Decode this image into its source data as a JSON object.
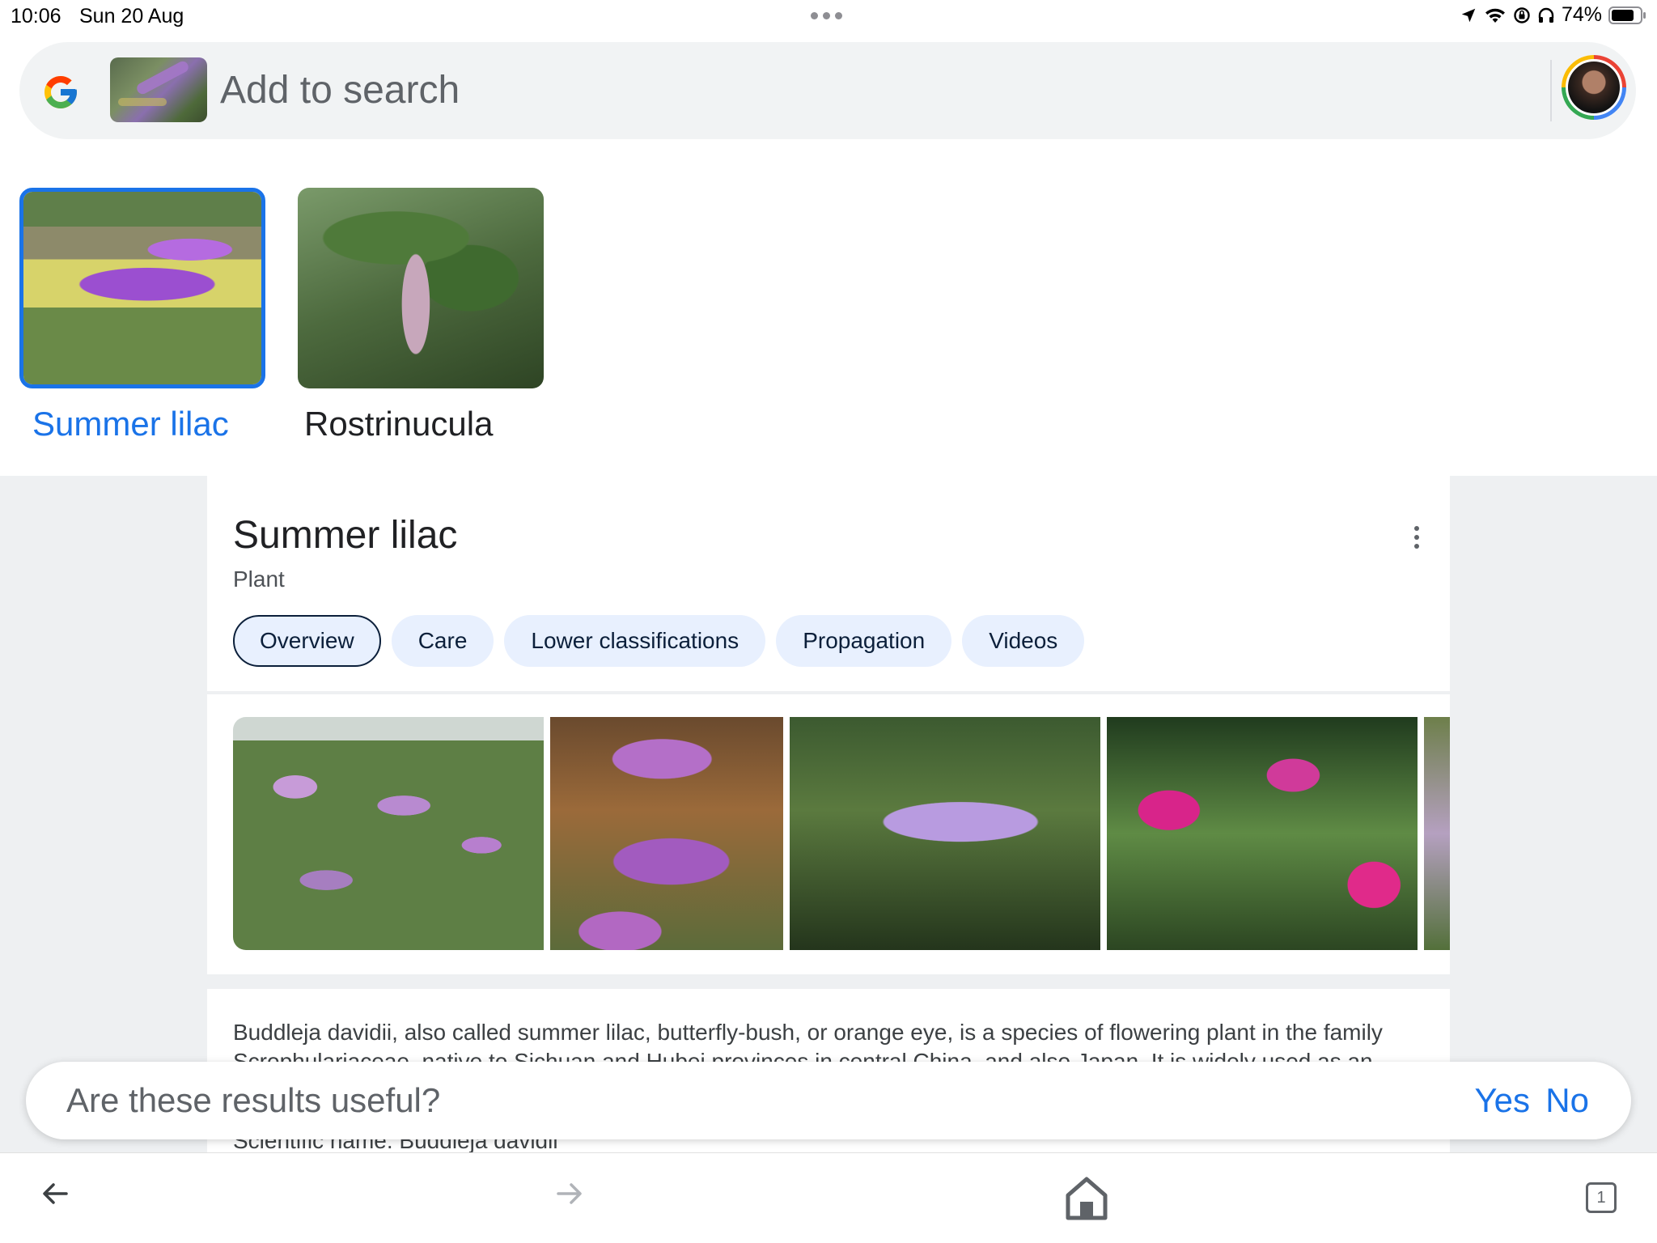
{
  "status_bar": {
    "time": "10:06",
    "date": "Sun 20 Aug",
    "battery_percent": "74%",
    "icons": [
      "location-arrow-icon",
      "wifi-icon",
      "rotation-lock-icon",
      "headphones-icon",
      "battery-icon"
    ]
  },
  "search": {
    "placeholder": "Add to search"
  },
  "results": [
    {
      "label": "Summer lilac",
      "selected": true
    },
    {
      "label": "Rostrinucula",
      "selected": false
    }
  ],
  "panel": {
    "title": "Summer lilac",
    "subtitle": "Plant",
    "tabs": [
      "Overview",
      "Care",
      "Lower classifications",
      "Propagation",
      "Videos"
    ],
    "active_tab": "Overview",
    "description": "Buddleja davidii, also called summer lilac, butterfly-bush, or orange eye, is a species of flowering plant in the family Scrophulariaceae, native to Sichuan and Hubei provinces in central China, and also Japan. It is widely used as an ornamental plant.",
    "fact_line": "Scientific name: Buddleja davidii"
  },
  "feedback": {
    "question": "Are these results useful?",
    "yes": "Yes",
    "no": "No"
  },
  "toolbar": {
    "tab_count": "1"
  },
  "colors": {
    "accent": "#1a73e8",
    "chip_bg": "#e8f0fe",
    "page_bg": "#eef0f2"
  }
}
